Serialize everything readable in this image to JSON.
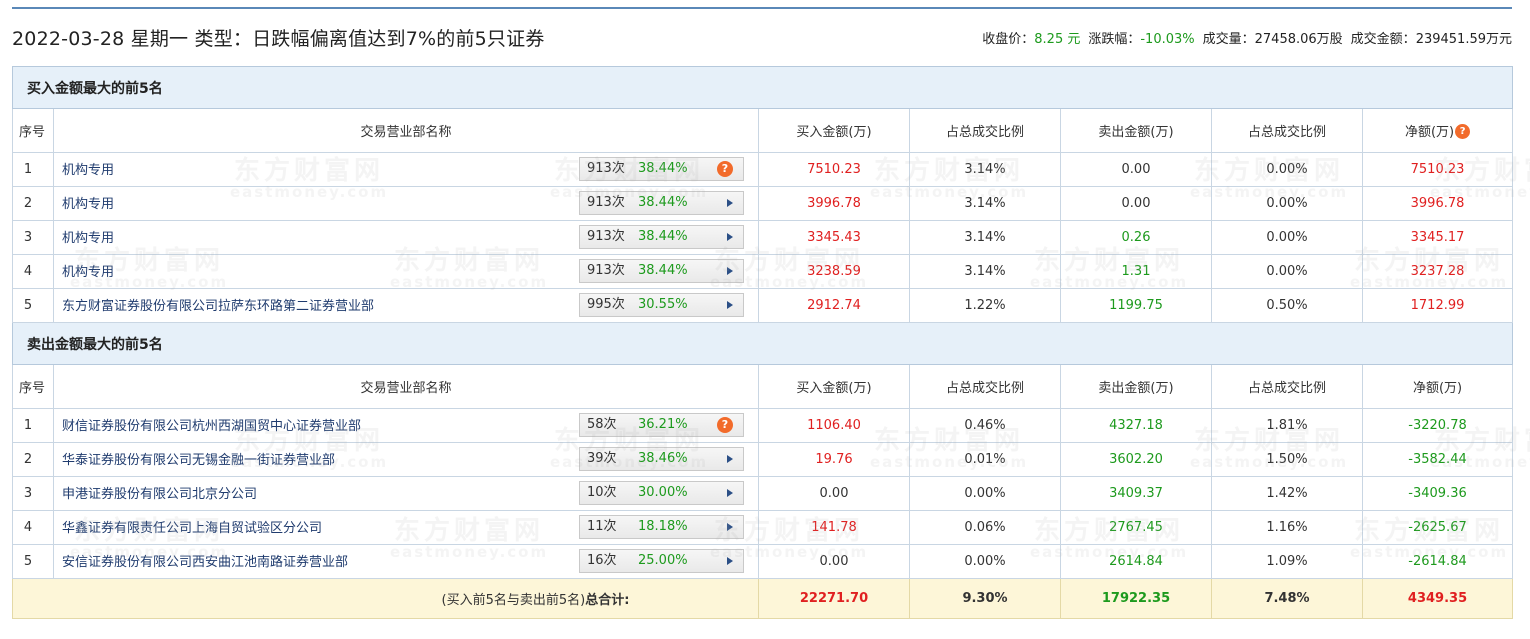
{
  "header": {
    "title": "2022-03-28 星期一 类型：日跌幅偏离值达到7%的前5只证券",
    "close_label": "收盘价：",
    "close_value": "8.25 元",
    "change_label": "涨跌幅：",
    "change_value": "-10.03%",
    "volume_label": "成交量：",
    "volume_value": "27458.06万股",
    "turnover_label": "成交金额：",
    "turnover_value": "239451.59万元"
  },
  "watermark": {
    "cn": "东方财富网",
    "en": "eastmoney.com"
  },
  "columns": {
    "idx": "序号",
    "name": "交易营业部名称",
    "buy": "买入金额(万)",
    "buy_ratio": "占总成交比例",
    "sell": "卖出金额(万)",
    "sell_ratio": "占总成交比例",
    "net": "净额(万)"
  },
  "buy_section": {
    "title": "买入金额最大的前5名",
    "rows": [
      {
        "idx": "1",
        "name": "机构专用",
        "count": "913次",
        "pct": "38.44%",
        "buy": "7510.23",
        "buy_ratio": "3.14%",
        "sell": "0.00",
        "sell_ratio": "0.00%",
        "net": "7510.23"
      },
      {
        "idx": "2",
        "name": "机构专用",
        "count": "913次",
        "pct": "38.44%",
        "buy": "3996.78",
        "buy_ratio": "3.14%",
        "sell": "0.00",
        "sell_ratio": "0.00%",
        "net": "3996.78"
      },
      {
        "idx": "3",
        "name": "机构专用",
        "count": "913次",
        "pct": "38.44%",
        "buy": "3345.43",
        "buy_ratio": "3.14%",
        "sell": "0.26",
        "sell_ratio": "0.00%",
        "net": "3345.17"
      },
      {
        "idx": "4",
        "name": "机构专用",
        "count": "913次",
        "pct": "38.44%",
        "buy": "3238.59",
        "buy_ratio": "3.14%",
        "sell": "1.31",
        "sell_ratio": "0.00%",
        "net": "3237.28"
      },
      {
        "idx": "5",
        "name": "东方财富证券股份有限公司拉萨东环路第二证券营业部",
        "count": "995次",
        "pct": "30.55%",
        "buy": "2912.74",
        "buy_ratio": "1.22%",
        "sell": "1199.75",
        "sell_ratio": "0.50%",
        "net": "1712.99"
      }
    ]
  },
  "sell_section": {
    "title": "卖出金额最大的前5名",
    "rows": [
      {
        "idx": "1",
        "name": "财信证券股份有限公司杭州西湖国贸中心证券营业部",
        "count": "58次",
        "pct": "36.21%",
        "buy": "1106.40",
        "buy_ratio": "0.46%",
        "sell": "4327.18",
        "sell_ratio": "1.81%",
        "net": "-3220.78"
      },
      {
        "idx": "2",
        "name": "华泰证券股份有限公司无锡金融一街证券营业部",
        "count": "39次",
        "pct": "38.46%",
        "buy": "19.76",
        "buy_ratio": "0.01%",
        "sell": "3602.20",
        "sell_ratio": "1.50%",
        "net": "-3582.44"
      },
      {
        "idx": "3",
        "name": "申港证券股份有限公司北京分公司",
        "count": "10次",
        "pct": "30.00%",
        "buy": "0.00",
        "buy_ratio": "0.00%",
        "sell": "3409.37",
        "sell_ratio": "1.42%",
        "net": "-3409.36"
      },
      {
        "idx": "4",
        "name": "华鑫证券有限责任公司上海自贸试验区分公司",
        "count": "11次",
        "pct": "18.18%",
        "buy": "141.78",
        "buy_ratio": "0.06%",
        "sell": "2767.45",
        "sell_ratio": "1.16%",
        "net": "-2625.67"
      },
      {
        "idx": "5",
        "name": "安信证券股份有限公司西安曲江池南路证券营业部",
        "count": "16次",
        "pct": "25.00%",
        "buy": "0.00",
        "buy_ratio": "0.00%",
        "sell": "2614.84",
        "sell_ratio": "1.09%",
        "net": "-2614.84"
      }
    ]
  },
  "total": {
    "label_prefix": "(买入前5名与卖出前5名)",
    "label_strong": "总合计:",
    "buy": "22271.70",
    "buy_ratio": "9.30%",
    "sell": "17922.35",
    "sell_ratio": "7.48%",
    "net": "4349.35"
  },
  "icons": {
    "hint": "?",
    "hint_color": "#f26b2b",
    "up_color": "#e02020",
    "down_color": "#1d9a1d"
  }
}
